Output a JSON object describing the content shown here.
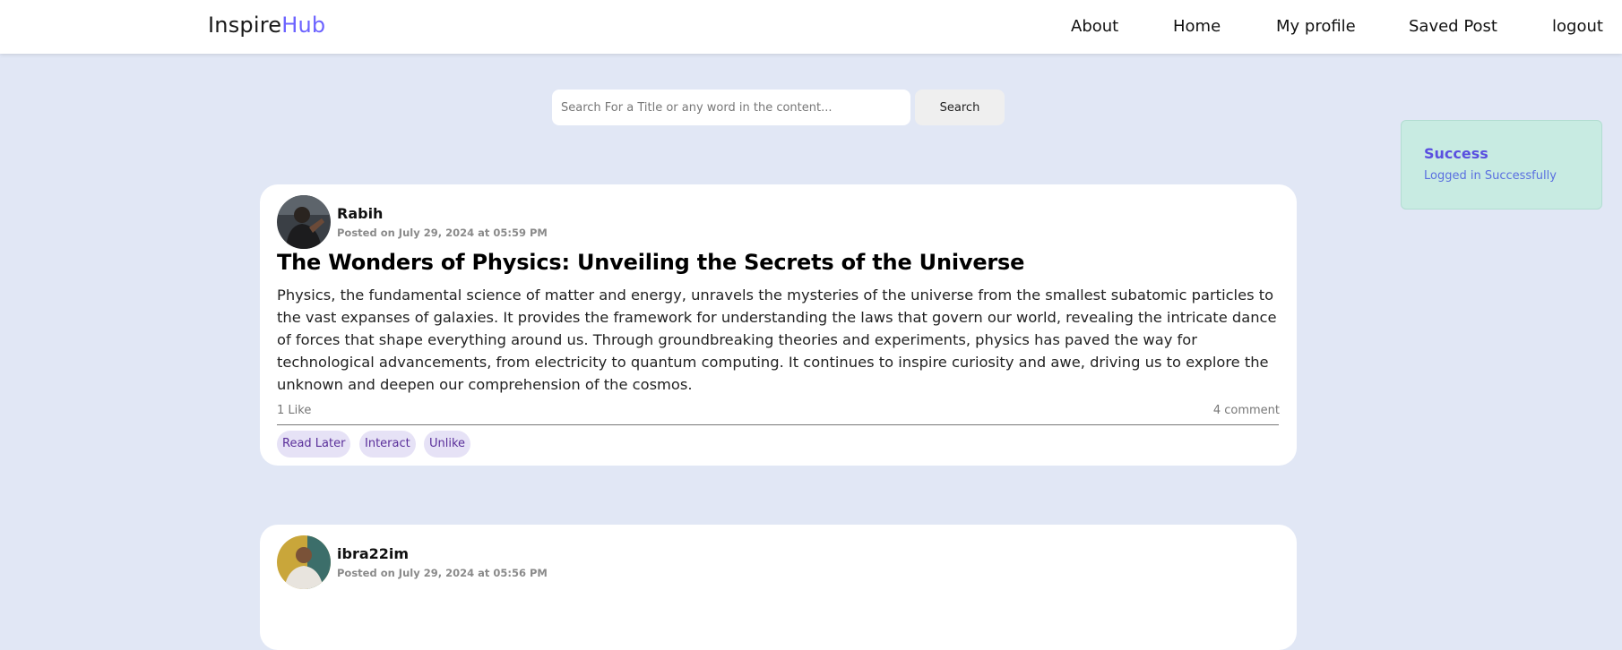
{
  "brand": {
    "name_main": "Inspire",
    "name_accent": "Hub",
    "accent_color": "#6c63ff"
  },
  "nav": {
    "items": [
      "About",
      "Home",
      "My profile",
      "Saved Post",
      "logout"
    ]
  },
  "search": {
    "placeholder": "Search For a Title or any word in the content...",
    "button_label": "Search"
  },
  "toast": {
    "title": "Success",
    "message": "Logged in Successfully"
  },
  "posts": [
    {
      "author": "Rabih",
      "posted_at": "Posted on July 29, 2024 at 05:59 PM",
      "title": "The Wonders of Physics: Unveiling the Secrets of the Universe",
      "body": "Physics, the fundamental science of matter and energy, unravels the mysteries of the universe from the smallest subatomic particles to the vast expanses of galaxies. It provides the framework for understanding the laws that govern our world, revealing the intricate dance of forces that shape everything around us. Through groundbreaking theories and experiments, physics has paved the way for technological advancements, from electricity to quantum computing. It continues to inspire curiosity and awe, driving us to explore the unknown and deepen our comprehension of the cosmos.",
      "likes": "1 Like",
      "comments": "4 comment",
      "actions": [
        "Read Later",
        "Interact",
        "Unlike"
      ]
    },
    {
      "author": "ibra22im",
      "posted_at": "Posted on July 29, 2024 at 05:56 PM"
    }
  ]
}
